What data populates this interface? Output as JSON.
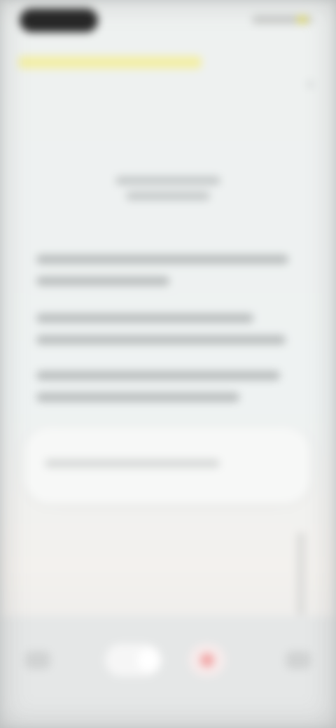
{
  "status_bar": {
    "icons": [
      "pill-indicator",
      "battery-icon"
    ]
  },
  "header": {
    "close_icon_glyph": "×"
  },
  "colors": {
    "highlight": "#f3efa6",
    "record_accent": "#f1a8a8",
    "background": "#eef1f0"
  }
}
